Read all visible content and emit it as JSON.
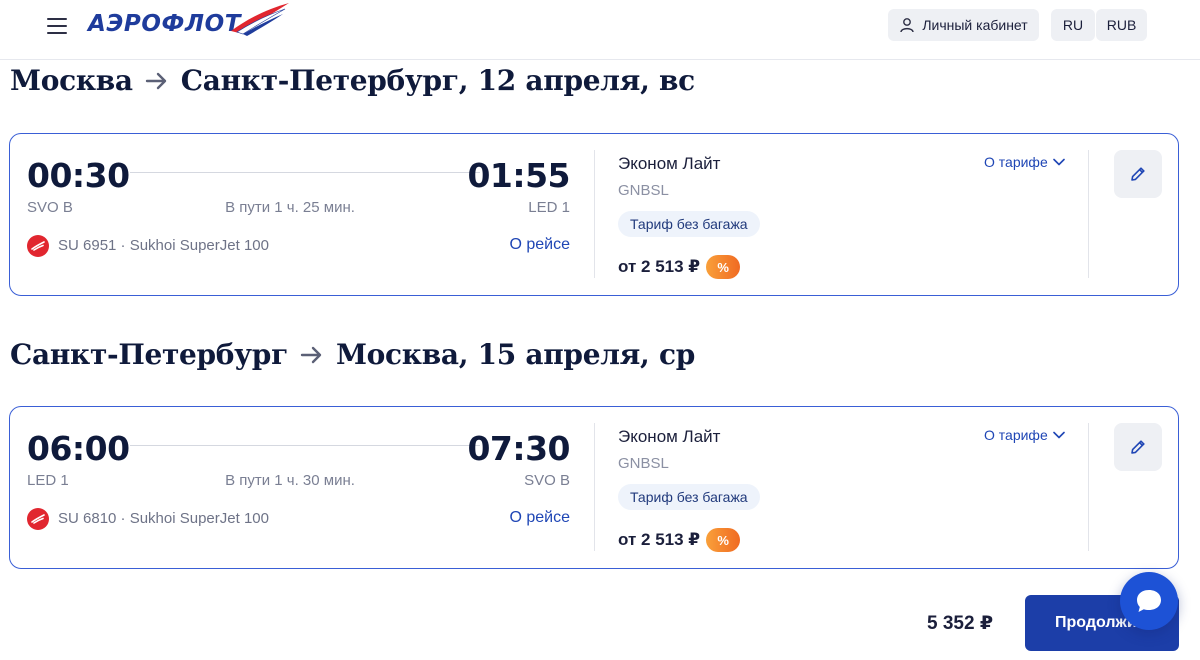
{
  "header": {
    "logo_text": "АЭРОФЛОТ",
    "cabinet_label": "Личный кабинет",
    "language": "RU",
    "currency": "RUB"
  },
  "segments": [
    {
      "route": {
        "from": "Москва",
        "to": "Санкт-Петербург, 12 апреля, вс"
      },
      "departure_time": "00:30",
      "arrival_time": "01:55",
      "departure_airport": "SVO B",
      "arrival_airport": "LED 1",
      "duration": "В пути 1 ч. 25 мин.",
      "flight_info": "SU 6951 · Sukhoi SuperJet 100",
      "about_flight": "О рейсе",
      "tariff_name": "Эконом Лайт",
      "tariff_code": "GNBSL",
      "about_tariff": "О тарифе",
      "tariff_badge": "Тариф без багажа",
      "price": "от 2 513 ₽",
      "discount": "%"
    },
    {
      "route": {
        "from": "Санкт-Петербург",
        "to": "Москва, 15 апреля, ср"
      },
      "departure_time": "06:00",
      "arrival_time": "07:30",
      "departure_airport": "LED 1",
      "arrival_airport": "SVO B",
      "duration": "В пути 1 ч. 30 мин.",
      "flight_info": "SU 6810 · Sukhoi SuperJet 100",
      "about_flight": "О рейсе",
      "tariff_name": "Эконом Лайт",
      "tariff_code": "GNBSL",
      "about_tariff": "О тарифе",
      "tariff_badge": "Тариф без багажа",
      "price": "от 2 513 ₽",
      "discount": "%"
    }
  ],
  "footer": {
    "total": "5 352 ₽",
    "continue_label": "Продолжить"
  },
  "colors": {
    "accent": "#1f46b5",
    "card_border": "#3a5fd6",
    "button": "#1c3ea8",
    "discount": "#f06a22",
    "brand_red": "#e1262f"
  },
  "icons": [
    "menu-icon",
    "aeroflot-logo",
    "user-icon",
    "arrow-right-icon",
    "airline-logo-icon",
    "chevron-down-icon",
    "pencil-icon",
    "chat-icon"
  ]
}
